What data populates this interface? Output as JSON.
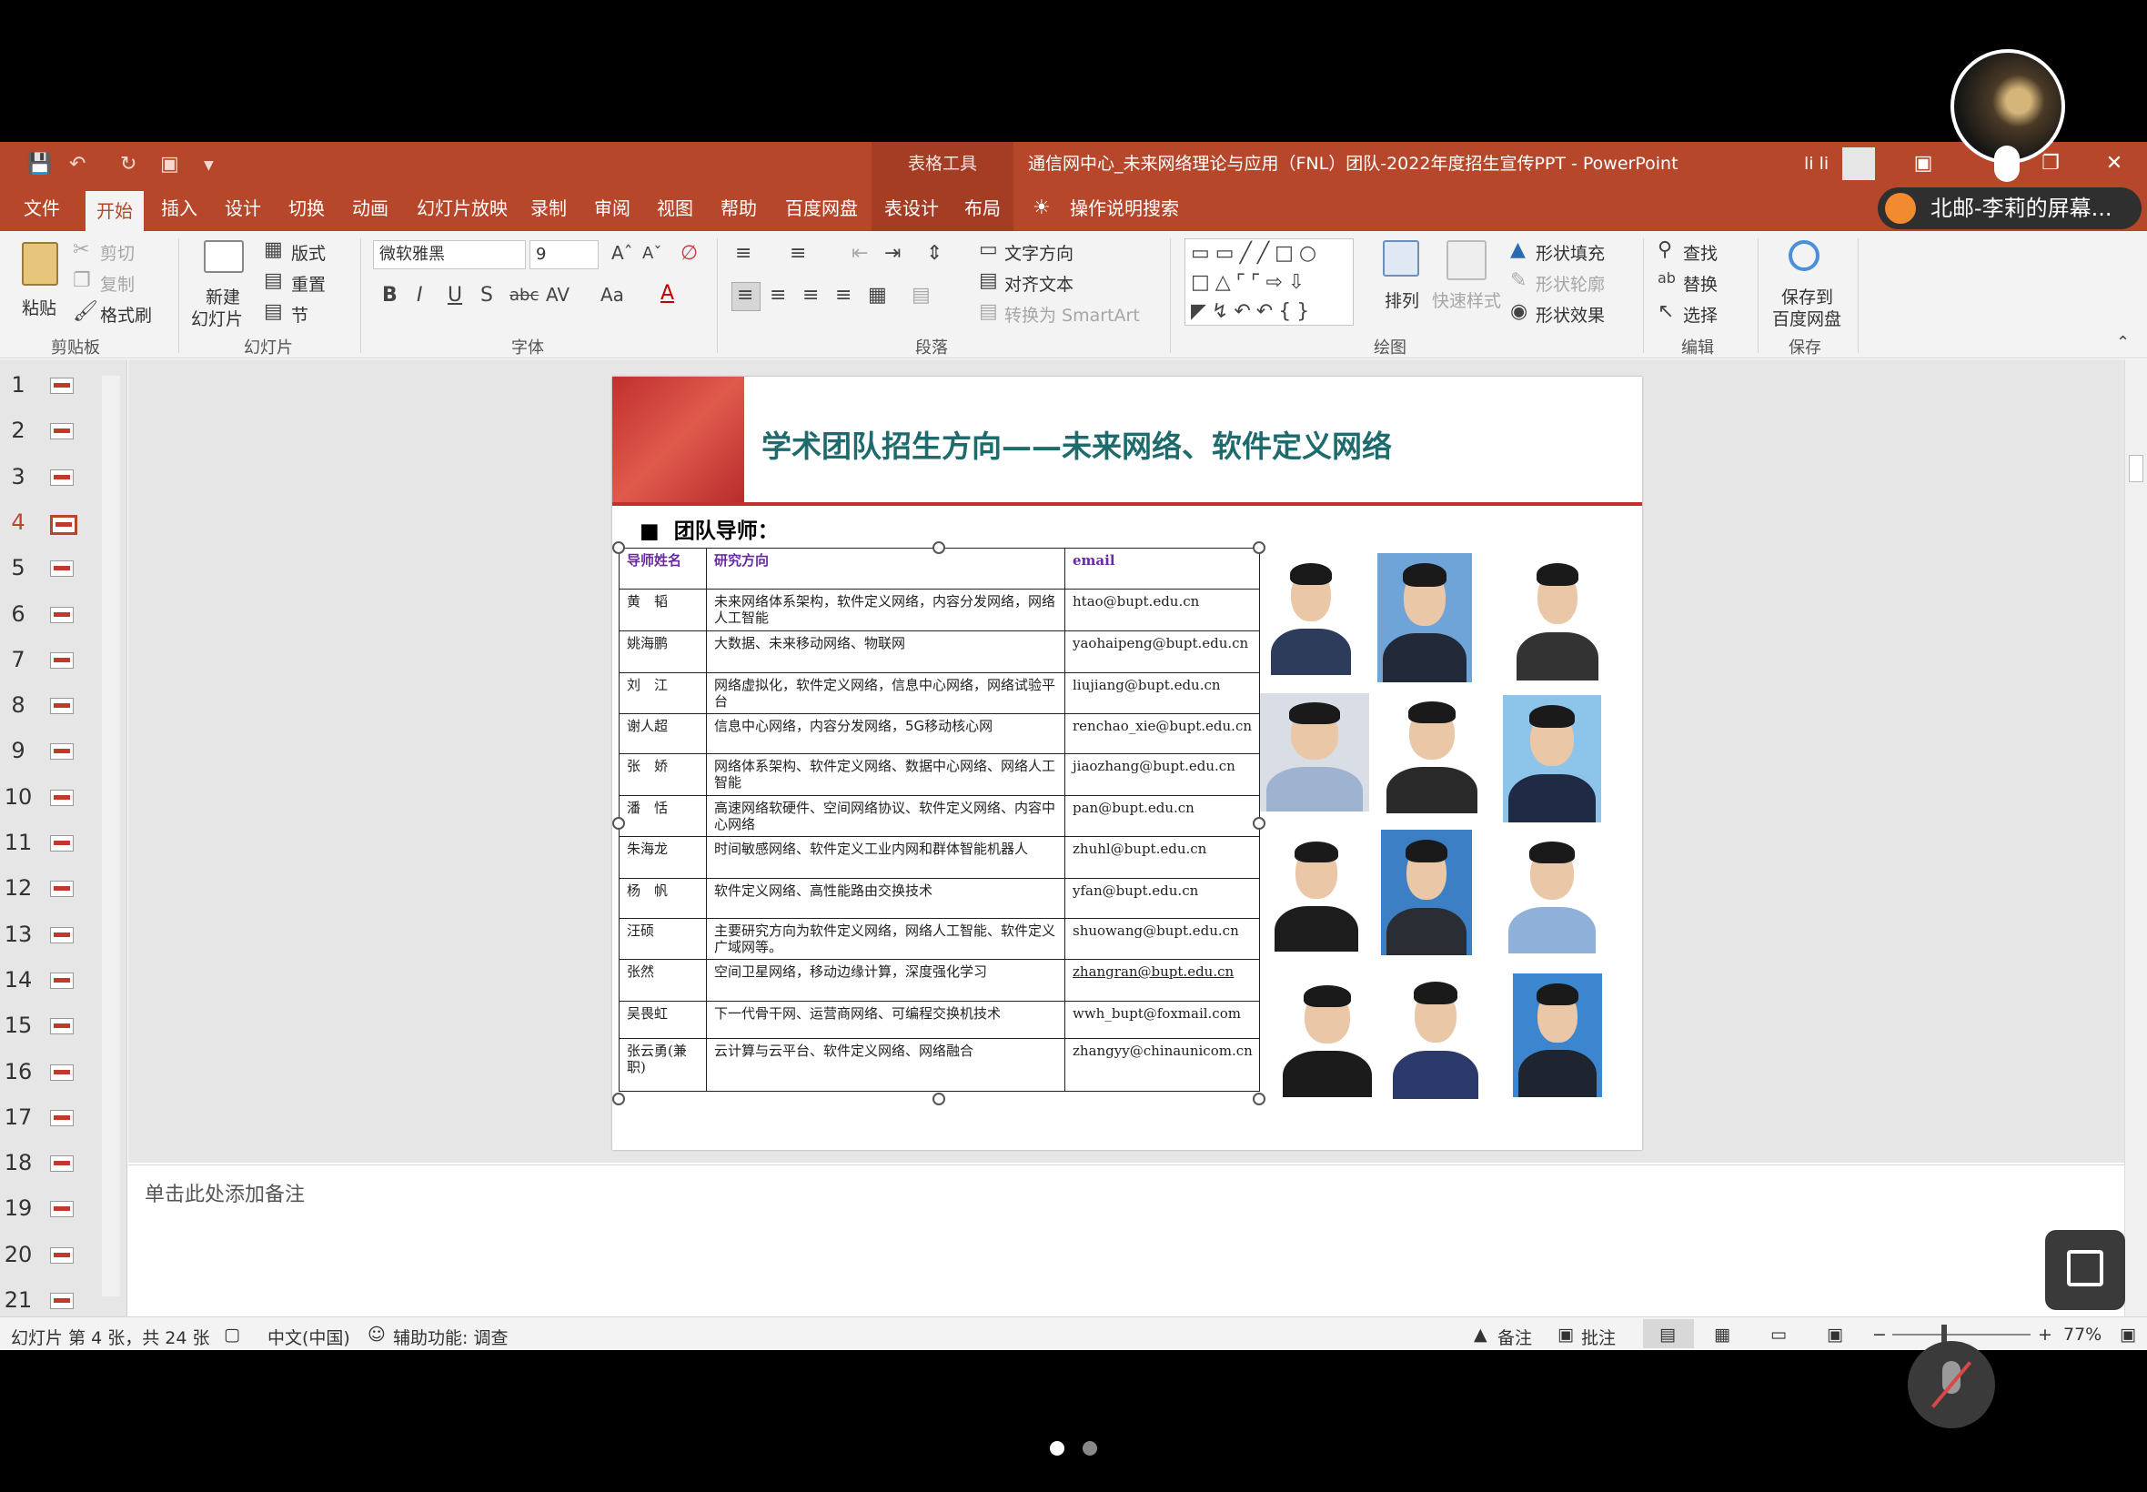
{
  "window": {
    "context_tab": "表格工具",
    "title": "通信网中心_未来网络理论与应用（FNL）团队-2022年度招生宣传PPT - PowerPoint",
    "user": "li li"
  },
  "tabs": [
    "文件",
    "开始",
    "插入",
    "设计",
    "切换",
    "动画",
    "幻灯片放映",
    "录制",
    "审阅",
    "视图",
    "帮助",
    "百度网盘",
    "表设计",
    "布局"
  ],
  "tell_me": "操作说明搜索",
  "ribbon": {
    "clipboard": {
      "paste": "粘贴",
      "cut": "剪切",
      "copy": "复制",
      "format_painter": "格式刷",
      "label": "剪贴板"
    },
    "slides": {
      "new_slide_1": "新建",
      "new_slide_2": "幻灯片",
      "layout": "版式",
      "reset": "重置",
      "section": "节",
      "label": "幻灯片"
    },
    "font": {
      "family": "微软雅黑",
      "size": "9",
      "label": "字体"
    },
    "paragraph": {
      "text_direction": "文字方向",
      "align_text": "对齐文本",
      "smartart": "转换为 SmartArt",
      "label": "段落"
    },
    "drawing": {
      "arrange": "排列",
      "quick_styles": "快速样式",
      "shape_fill": "形状填充",
      "shape_outline": "形状轮廓",
      "shape_effects": "形状效果",
      "label": "绘图"
    },
    "editing": {
      "find": "查找",
      "replace": "替换",
      "select": "选择",
      "label": "编辑"
    },
    "save": {
      "save_1": "保存到",
      "save_2": "百度网盘",
      "label": "保存"
    }
  },
  "thumbnails": [
    "1",
    "2",
    "3",
    "4",
    "5",
    "6",
    "7",
    "8",
    "9",
    "10",
    "11",
    "12",
    "13",
    "14",
    "15",
    "16",
    "17",
    "18",
    "19",
    "20",
    "21"
  ],
  "current_slide": "4",
  "slide": {
    "title": "学术团队招生方向——未来网络、软件定义网络",
    "section_head": "团队导师：",
    "bullet": "■",
    "table_header": [
      "导师姓名",
      "研究方向",
      "email"
    ],
    "rows": [
      [
        "黄　韬",
        "未来网络体系架构，软件定义网络，内容分发网络，网络人工智能",
        "htao@bupt.edu.cn"
      ],
      [
        "姚海鹏",
        "大数据、未来移动网络、物联网",
        "yaohaipeng@bupt.edu.cn"
      ],
      [
        "刘　江",
        "网络虚拟化，软件定义网络，信息中心网络，网络试验平台",
        "liujiang@bupt.edu.cn"
      ],
      [
        "谢人超",
        "信息中心网络，内容分发网络，5G移动核心网",
        "renchao_xie@bupt.edu.cn"
      ],
      [
        "张　娇",
        "网络体系架构、软件定义网络、数据中心网络、网络人工智能",
        "jiaozhang@bupt.edu.cn"
      ],
      [
        "潘　恬",
        "高速网络软硬件、空间网络协议、软件定义网络、内容中心网络",
        "pan@bupt.edu.cn"
      ],
      [
        "朱海龙",
        "时间敏感网络、软件定义工业内网和群体智能机器人",
        "zhuhl@bupt.edu.cn"
      ],
      [
        "杨　帆",
        "软件定义网络、高性能路由交换技术",
        "yfan@bupt.edu.cn"
      ],
      [
        "汪硕",
        "主要研究方向为软件定义网络，网络人工智能、软件定义广域网等。",
        "shuowang@bupt.edu.cn"
      ],
      [
        "张然",
        "空间卫星网络，移动边缘计算，深度强化学习",
        "zhangran@bupt.edu.cn"
      ],
      [
        "吴畏虹",
        "下一代骨干网、运营商网络、可编程交换机技术",
        "wwh_bupt@foxmail.com"
      ],
      [
        "张云勇(兼职)",
        "云计算与云平台、软件定义网络、网络融合",
        "zhangyy@chinaunicom.cn"
      ]
    ]
  },
  "notes_placeholder": "单击此处添加备注",
  "status": {
    "slide_info": "幻灯片 第 4 张，共 24 张",
    "language": "中文(中国)",
    "accessibility": "辅助功能: 调查",
    "notes": "备注",
    "comments": "批注",
    "zoom": "77%"
  },
  "overlay": {
    "share_label": "北邮-李莉的屏幕..."
  },
  "colors": {
    "brand": "#b7472a",
    "title_teal": "#1e6b6e",
    "header_purple": "#6a2ba0",
    "slide_red": "#c0302e"
  }
}
